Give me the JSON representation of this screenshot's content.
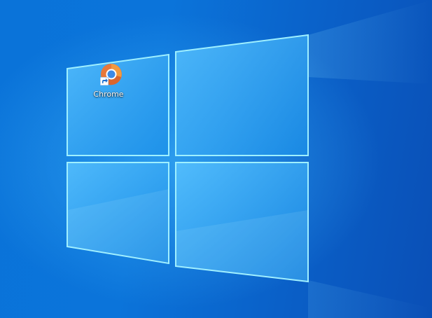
{
  "desktop": {
    "wallpaper_colors": {
      "base": "#0a6fd6",
      "glow": "#4fc3ff",
      "pane": "#3aa8f0",
      "edge": "#9ff0ff"
    },
    "icons": [
      {
        "label": "Chrome",
        "icon": "chrome-icon",
        "shortcut": true
      }
    ]
  }
}
